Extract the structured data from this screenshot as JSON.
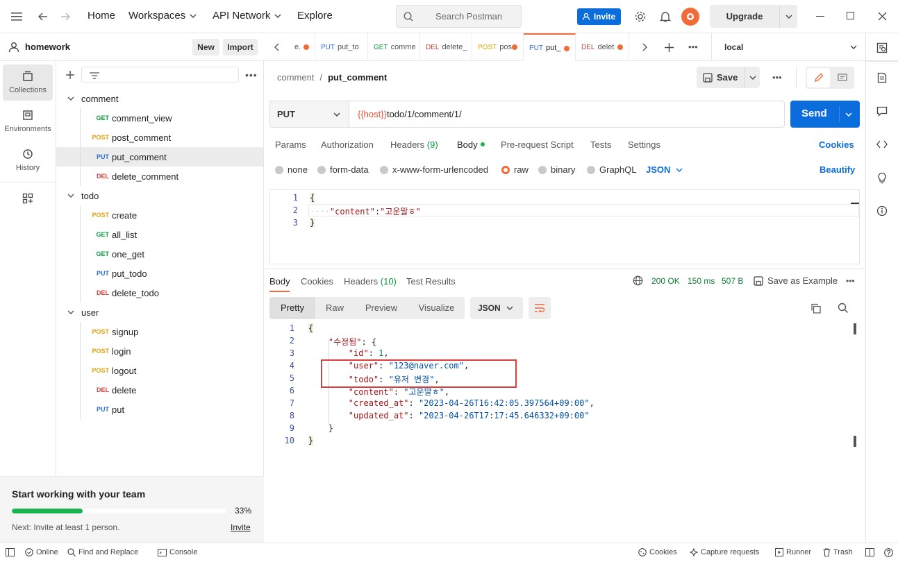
{
  "topbar": {
    "nav": [
      "Home",
      "Workspaces",
      "API Network",
      "Explore"
    ],
    "search_placeholder": "Search Postman",
    "invite_label": "Invite",
    "upgrade_label": "Upgrade"
  },
  "workspace": {
    "name": "homework",
    "new_label": "New",
    "import_label": "Import"
  },
  "rail": [
    {
      "label": "Collections",
      "icon": "collections-icon"
    },
    {
      "label": "Environments",
      "icon": "environments-icon"
    },
    {
      "label": "History",
      "icon": "history-icon"
    }
  ],
  "tree": [
    {
      "type": "folder",
      "label": "comment"
    },
    {
      "type": "req",
      "method": "GET",
      "label": "comment_view"
    },
    {
      "type": "req",
      "method": "POST",
      "label": "post_comment"
    },
    {
      "type": "req",
      "method": "PUT",
      "label": "put_comment",
      "selected": true
    },
    {
      "type": "req",
      "method": "DEL",
      "label": "delete_comment"
    },
    {
      "type": "folder",
      "label": "todo"
    },
    {
      "type": "req",
      "method": "POST",
      "label": "create"
    },
    {
      "type": "req",
      "method": "GET",
      "label": "all_list"
    },
    {
      "type": "req",
      "method": "GET",
      "label": "one_get"
    },
    {
      "type": "req",
      "method": "PUT",
      "label": "put_todo"
    },
    {
      "type": "req",
      "method": "DEL",
      "label": "delete_todo"
    },
    {
      "type": "folder",
      "label": "user"
    },
    {
      "type": "req",
      "method": "POST",
      "label": "signup"
    },
    {
      "type": "req",
      "method": "POST",
      "label": "login"
    },
    {
      "type": "req",
      "method": "POST",
      "label": "logout"
    },
    {
      "type": "req",
      "method": "DEL",
      "label": "delete"
    },
    {
      "type": "req",
      "method": "PUT",
      "label": "put"
    }
  ],
  "team": {
    "title": "Start working with your team",
    "percent": "33%",
    "progress": 0.33,
    "next": "Next: Invite at least 1 person.",
    "invite": "Invite"
  },
  "tabs": [
    {
      "method": "",
      "label": "e.",
      "dot": true
    },
    {
      "method": "PUT",
      "label": "put_to",
      "dot": false
    },
    {
      "method": "GET",
      "label": "comme",
      "dot": false
    },
    {
      "method": "DEL",
      "label": "delete_",
      "dot": false
    },
    {
      "method": "POST",
      "label": "pos",
      "dot": true
    },
    {
      "method": "PUT",
      "label": "put_",
      "dot": true
    },
    {
      "method": "DEL",
      "label": "delet",
      "dot": true
    }
  ],
  "environment": "local",
  "breadcrumb": {
    "parent": "comment",
    "current": "put_comment"
  },
  "save_label": "Save",
  "request": {
    "method": "PUT",
    "url_var": "{{host}}",
    "url_path": "todo/1/comment/1/",
    "send_label": "Send"
  },
  "req_tabs": [
    "Params",
    "Authorization",
    "Headers",
    "(9)",
    "Body",
    "Pre-request Script",
    "Tests",
    "Settings"
  ],
  "cookies_label": "Cookies",
  "body_types": [
    "none",
    "form-data",
    "x-www-form-urlencoded",
    "raw",
    "binary",
    "GraphQL"
  ],
  "body_format": "JSON",
  "beautify_label": "Beautify",
  "req_body": {
    "lines": [
      "1",
      "2",
      "3"
    ],
    "brace_open": "{",
    "key": "\"content\"",
    "colon": ":",
    "value": "\"고운말ㅎ\"",
    "brace_close": "}",
    "indent": "····"
  },
  "resp_tabs": [
    "Body",
    "Cookies",
    "Headers",
    "(10)",
    "Test Results"
  ],
  "resp_meta": {
    "status": "200 OK",
    "time": "150 ms",
    "size": "507 B",
    "save_example": "Save as Example"
  },
  "view_tabs": [
    "Pretty",
    "Raw",
    "Preview",
    "Visualize"
  ],
  "resp_format": "JSON",
  "resp_body": {
    "lines": [
      "1",
      "2",
      "3",
      "4",
      "5",
      "6",
      "7",
      "8",
      "9",
      "10"
    ],
    "l1": "{",
    "l2_key": "\"수정됨\"",
    "l2_rest": ": {",
    "l3_key": "\"id\"",
    "l3_val": "1",
    "l3_end": ",",
    "l4_key": "\"user\"",
    "l4_val": "\"123@naver.com\"",
    "l4_end": ",",
    "l5_key": "\"todo\"",
    "l5_val": "\"유저 변경\"",
    "l5_end": ",",
    "l6_key": "\"content\"",
    "l6_val": "\"고운말ㅎ\"",
    "l6_end": ",",
    "l7_key": "\"created_at\"",
    "l7_val": "\"2023-04-26T16:42:05.397564+09:00\"",
    "l7_end": ",",
    "l8_key": "\"updated_at\"",
    "l8_val": "\"2023-04-26T17:17:45.646332+09:00\"",
    "l9": "}",
    "l10": "}",
    "colon": ": "
  },
  "statusbar": {
    "online": "Online",
    "find": "Find and Replace",
    "console": "Console",
    "cookies": "Cookies",
    "capture": "Capture requests",
    "runner": "Runner",
    "trash": "Trash"
  },
  "colors": {
    "accent": "#0b6cdb",
    "orange": "#f26b3a",
    "highlight_box": "#e03c3c",
    "progress": "#1ab34e"
  }
}
